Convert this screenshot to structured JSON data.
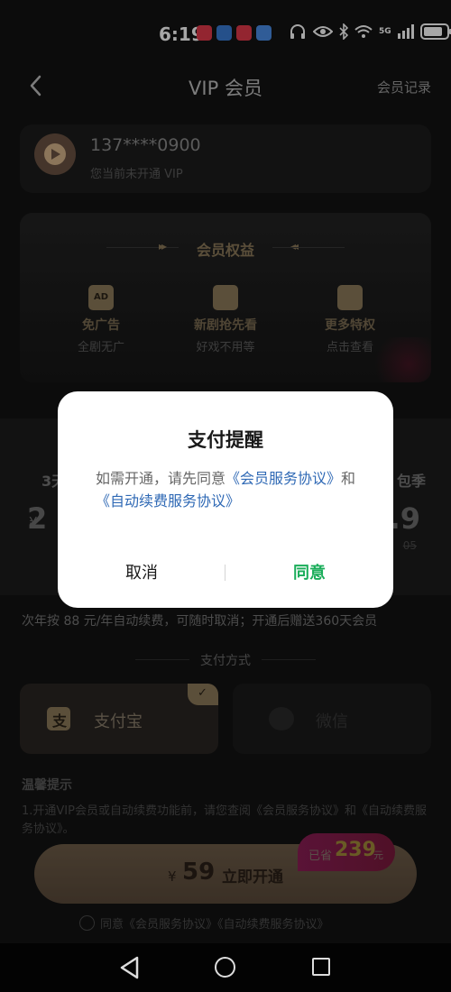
{
  "status_bar": {
    "time": "6:19",
    "network": "5G",
    "signal_label": "6",
    "battery_level": 0.85,
    "app_icon_colors": [
      "#e23a4a",
      "#3a7bd5",
      "#e23a4a",
      "#4a8ee8"
    ]
  },
  "header": {
    "title": "VIP 会员",
    "records_label": "会员记录"
  },
  "user": {
    "phone": "137****0900",
    "status": "您当前未开通 VIP"
  },
  "benefits": {
    "title": "会员权益",
    "items": [
      {
        "icon": "ad-free-icon",
        "icon_text": "AD",
        "name": "免广告",
        "desc": "全剧无广"
      },
      {
        "icon": "early-access-icon",
        "icon_text": "",
        "name": "新剧抢先看",
        "desc": "好戏不用等"
      },
      {
        "icon": "crown-icon",
        "icon_text": "",
        "name": "更多特权",
        "desc": "点击查看"
      }
    ]
  },
  "plans": {
    "left_name": "3天",
    "left_currency": "¥",
    "left_price": "2",
    "right_name": "包季",
    "right_price": "6.9",
    "right_orig": "05"
  },
  "renew_note": "次年按 88 元/年自动续费，可随时取消；开通后赠送360天会员",
  "payment": {
    "title": "支付方式",
    "alipay_label": "支付宝",
    "alipay_icon_text": "支",
    "check_mark": "✓",
    "wechat_label": "微信"
  },
  "tips": {
    "title": "温馨提示",
    "body": "1.开通VIP会员或自动续费功能前，请您查阅《会员服务协议》和《自动续费服务协议》。"
  },
  "cta": {
    "currency": "¥",
    "price": "59",
    "label": "立即开通",
    "save_prefix": "已省",
    "save_amount": "239",
    "save_suffix": "元"
  },
  "agreement": {
    "text": "同意《会员服务协议》《自动续费服务协议》"
  },
  "dialog": {
    "title": "支付提醒",
    "message_prefix": "如需开通，请先同意",
    "link_service": "《会员服务协议》",
    "message_and": "和",
    "link_renew": "《自动续费服务协议》",
    "cancel_label": "取消",
    "agree_label": "同意",
    "agree_color": "#1aad5a"
  }
}
